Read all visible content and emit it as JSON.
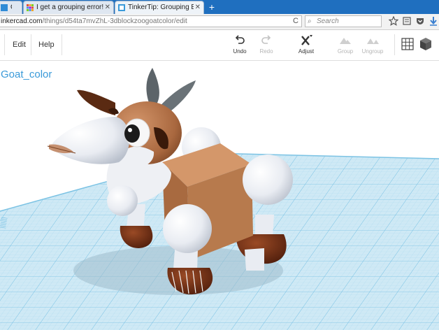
{
  "browser": {
    "tabs": [
      {
        "title": "Go...",
        "active": false
      },
      {
        "title": "I get a grouping error! Wh...",
        "active": false
      },
      {
        "title": "TinkerTip: Grouping Errors...",
        "active": true
      }
    ],
    "new_tab": "+",
    "url_host": "inkercad.com",
    "url_path": "/things/d54ta7mvZhL-3dblockzoogoatcolor/edit",
    "reload": "C",
    "search_placeholder": "Search"
  },
  "app": {
    "menu": {
      "edit": "Edit",
      "help": "Help"
    },
    "tools": {
      "undo": "Undo",
      "redo": "Redo",
      "adjust": "Adjust",
      "group": "Group",
      "ungroup": "Ungroup"
    },
    "design_title": "Goat_color"
  },
  "colors": {
    "tab_strip": "#1f6fbf",
    "title": "#3a9ad9",
    "grid_fill": "#cfe9f5",
    "grid_line": "#8cc9e6",
    "goat_brown": "#b5774b",
    "goat_white": "#eef0f4",
    "horn_gray": "#5c6469",
    "hoof_dark": "#6b2d16"
  }
}
